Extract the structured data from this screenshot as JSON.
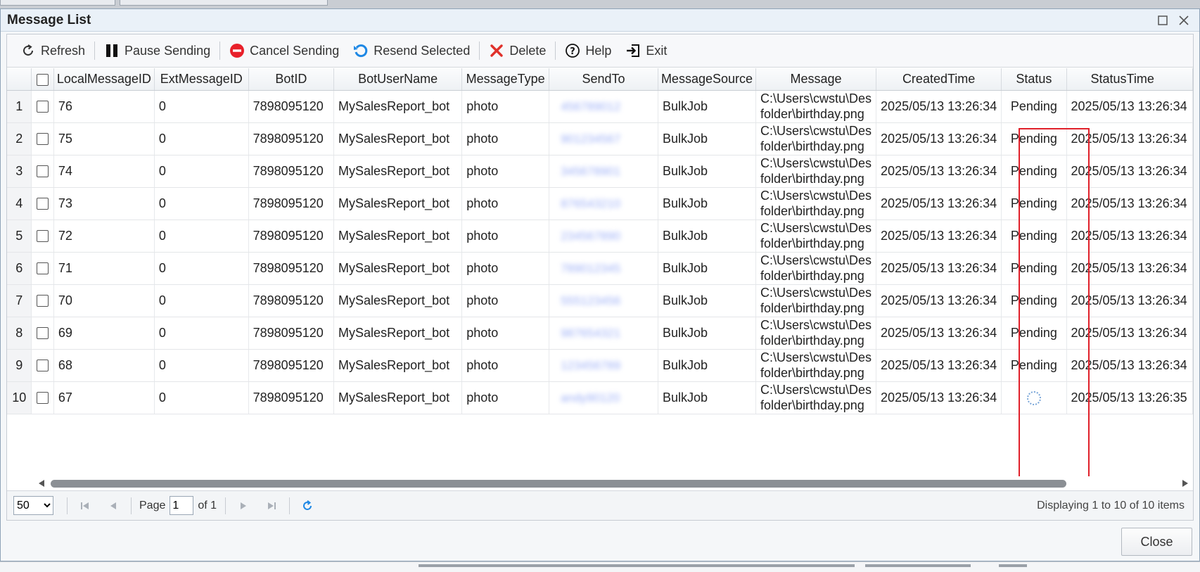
{
  "window": {
    "title": "Message List"
  },
  "toolbar": {
    "refresh": "Refresh",
    "pause": "Pause Sending",
    "cancel": "Cancel Sending",
    "resend": "Resend Selected",
    "delete": "Delete",
    "help": "Help",
    "exit": "Exit"
  },
  "grid": {
    "columns": [
      "LocalMessageID",
      "ExtMessageID",
      "BotID",
      "BotUserName",
      "MessageType",
      "SendTo",
      "MessageSource",
      "Message",
      "CreatedTime",
      "Status",
      "StatusTime"
    ],
    "rows": [
      {
        "num": "1",
        "local_id": "76",
        "ext_id": "0",
        "bot_id": "7898095120",
        "bot_user": "MySalesReport_bot",
        "type": "photo",
        "send_to": "456789012",
        "source": "BulkJob",
        "msg_line1": "C:\\Users\\cwstu\\Des",
        "msg_line2": "folder\\birthday.png",
        "created": "2025/05/13 13:26:34",
        "status": "Pending",
        "status_time": "2025/05/13 13:26:34"
      },
      {
        "num": "2",
        "local_id": "75",
        "ext_id": "0",
        "bot_id": "7898095120",
        "bot_user": "MySalesReport_bot",
        "type": "photo",
        "send_to": "901234567",
        "source": "BulkJob",
        "msg_line1": "C:\\Users\\cwstu\\Des",
        "msg_line2": "folder\\birthday.png",
        "created": "2025/05/13 13:26:34",
        "status": "Pending",
        "status_time": "2025/05/13 13:26:34"
      },
      {
        "num": "3",
        "local_id": "74",
        "ext_id": "0",
        "bot_id": "7898095120",
        "bot_user": "MySalesReport_bot",
        "type": "photo",
        "send_to": "345678901",
        "source": "BulkJob",
        "msg_line1": "C:\\Users\\cwstu\\Des",
        "msg_line2": "folder\\birthday.png",
        "created": "2025/05/13 13:26:34",
        "status": "Pending",
        "status_time": "2025/05/13 13:26:34"
      },
      {
        "num": "4",
        "local_id": "73",
        "ext_id": "0",
        "bot_id": "7898095120",
        "bot_user": "MySalesReport_bot",
        "type": "photo",
        "send_to": "876543210",
        "source": "BulkJob",
        "msg_line1": "C:\\Users\\cwstu\\Des",
        "msg_line2": "folder\\birthday.png",
        "created": "2025/05/13 13:26:34",
        "status": "Pending",
        "status_time": "2025/05/13 13:26:34"
      },
      {
        "num": "5",
        "local_id": "72",
        "ext_id": "0",
        "bot_id": "7898095120",
        "bot_user": "MySalesReport_bot",
        "type": "photo",
        "send_to": "234567890",
        "source": "BulkJob",
        "msg_line1": "C:\\Users\\cwstu\\Des",
        "msg_line2": "folder\\birthday.png",
        "created": "2025/05/13 13:26:34",
        "status": "Pending",
        "status_time": "2025/05/13 13:26:34"
      },
      {
        "num": "6",
        "local_id": "71",
        "ext_id": "0",
        "bot_id": "7898095120",
        "bot_user": "MySalesReport_bot",
        "type": "photo",
        "send_to": "789012345",
        "source": "BulkJob",
        "msg_line1": "C:\\Users\\cwstu\\Des",
        "msg_line2": "folder\\birthday.png",
        "created": "2025/05/13 13:26:34",
        "status": "Pending",
        "status_time": "2025/05/13 13:26:34"
      },
      {
        "num": "7",
        "local_id": "70",
        "ext_id": "0",
        "bot_id": "7898095120",
        "bot_user": "MySalesReport_bot",
        "type": "photo",
        "send_to": "555123456",
        "source": "BulkJob",
        "msg_line1": "C:\\Users\\cwstu\\Des",
        "msg_line2": "folder\\birthday.png",
        "created": "2025/05/13 13:26:34",
        "status": "Pending",
        "status_time": "2025/05/13 13:26:34"
      },
      {
        "num": "8",
        "local_id": "69",
        "ext_id": "0",
        "bot_id": "7898095120",
        "bot_user": "MySalesReport_bot",
        "type": "photo",
        "send_to": "987654321",
        "source": "BulkJob",
        "msg_line1": "C:\\Users\\cwstu\\Des",
        "msg_line2": "folder\\birthday.png",
        "created": "2025/05/13 13:26:34",
        "status": "Pending",
        "status_time": "2025/05/13 13:26:34"
      },
      {
        "num": "9",
        "local_id": "68",
        "ext_id": "0",
        "bot_id": "7898095120",
        "bot_user": "MySalesReport_bot",
        "type": "photo",
        "send_to": "123456789",
        "source": "BulkJob",
        "msg_line1": "C:\\Users\\cwstu\\Des",
        "msg_line2": "folder\\birthday.png",
        "created": "2025/05/13 13:26:34",
        "status": "Pending",
        "status_time": "2025/05/13 13:26:34"
      },
      {
        "num": "10",
        "local_id": "67",
        "ext_id": "0",
        "bot_id": "7898095120",
        "bot_user": "MySalesReport_bot",
        "type": "photo",
        "send_to": "andy90120",
        "source": "BulkJob",
        "msg_line1": "C:\\Users\\cwstu\\Des",
        "msg_line2": "folder\\birthday.png",
        "created": "2025/05/13 13:26:34",
        "status": "",
        "status_time": "2025/05/13 13:26:35"
      }
    ]
  },
  "pager": {
    "page_size": "50",
    "page_label": "Page",
    "page_value": "1",
    "of_label": "of 1",
    "display": "Displaying 1 to 10 of 10 items"
  },
  "footer": {
    "close": "Close"
  },
  "colors": {
    "link": "#1f3fd8",
    "highlight": "#e0202a",
    "cancel_icon": "#e8202a",
    "resend_icon": "#1e88e5",
    "delete_icon": "#e0302a"
  }
}
